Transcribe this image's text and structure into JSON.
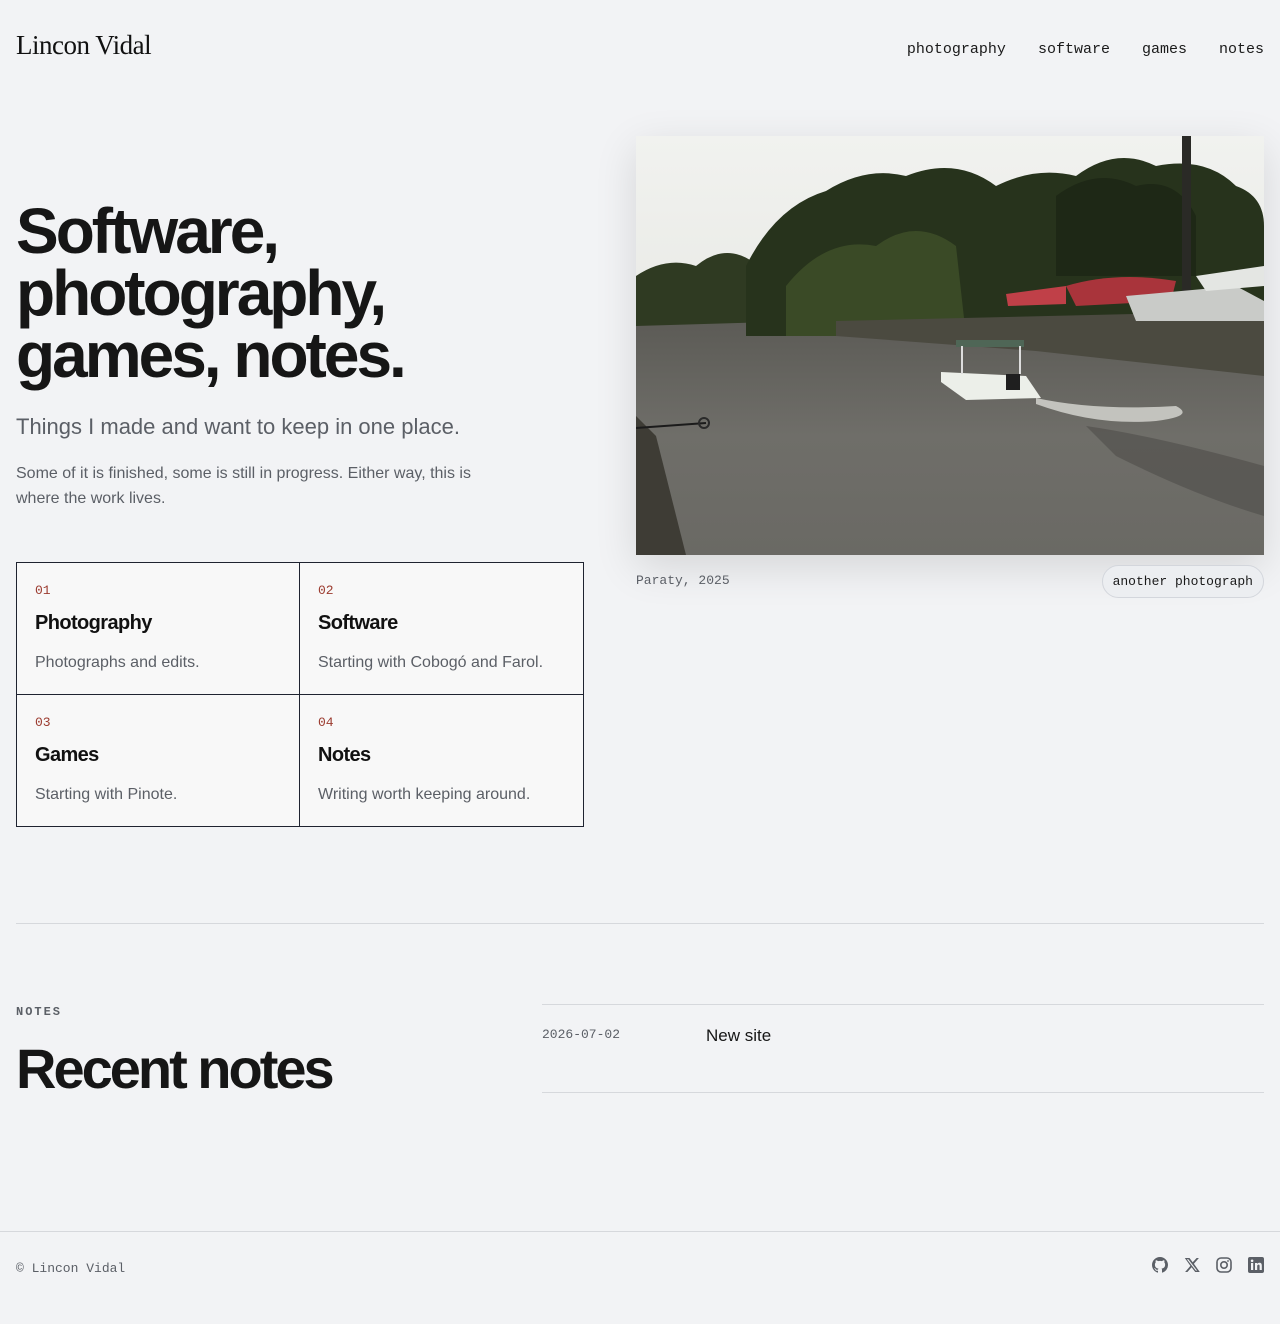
{
  "header": {
    "site_title": "Lincon Vidal",
    "nav": [
      "photography",
      "software",
      "games",
      "notes"
    ]
  },
  "hero": {
    "heading_lines": [
      "Software,",
      "photography,",
      "games, notes."
    ],
    "subtitle": "Things I made and want to keep in one place.",
    "description": "Some of it is finished, some is still in progress. Either way, this is where the work lives."
  },
  "cards": [
    {
      "num": "01",
      "title": "Photography",
      "desc": "Photographs and edits."
    },
    {
      "num": "02",
      "title": "Software",
      "desc": "Starting with Cobogó and Farol."
    },
    {
      "num": "03",
      "title": "Games",
      "desc": "Starting with Pinote."
    },
    {
      "num": "04",
      "title": "Notes",
      "desc": "Writing worth keeping around."
    }
  ],
  "photo": {
    "caption": "Paraty, 2025",
    "button_label": "another photograph"
  },
  "notes": {
    "label": "NOTES",
    "heading": "Recent notes",
    "items": [
      {
        "date": "2026-07-02",
        "title": "New site"
      }
    ]
  },
  "footer": {
    "copyright": "© Lincon Vidal",
    "social_icons": [
      "github-icon",
      "x-icon",
      "instagram-icon",
      "linkedin-icon"
    ]
  },
  "colors": {
    "background": "#f2f3f5",
    "accent_number": "#9b3a2e",
    "text_muted": "#5b5f66",
    "text_strong": "#161616"
  }
}
